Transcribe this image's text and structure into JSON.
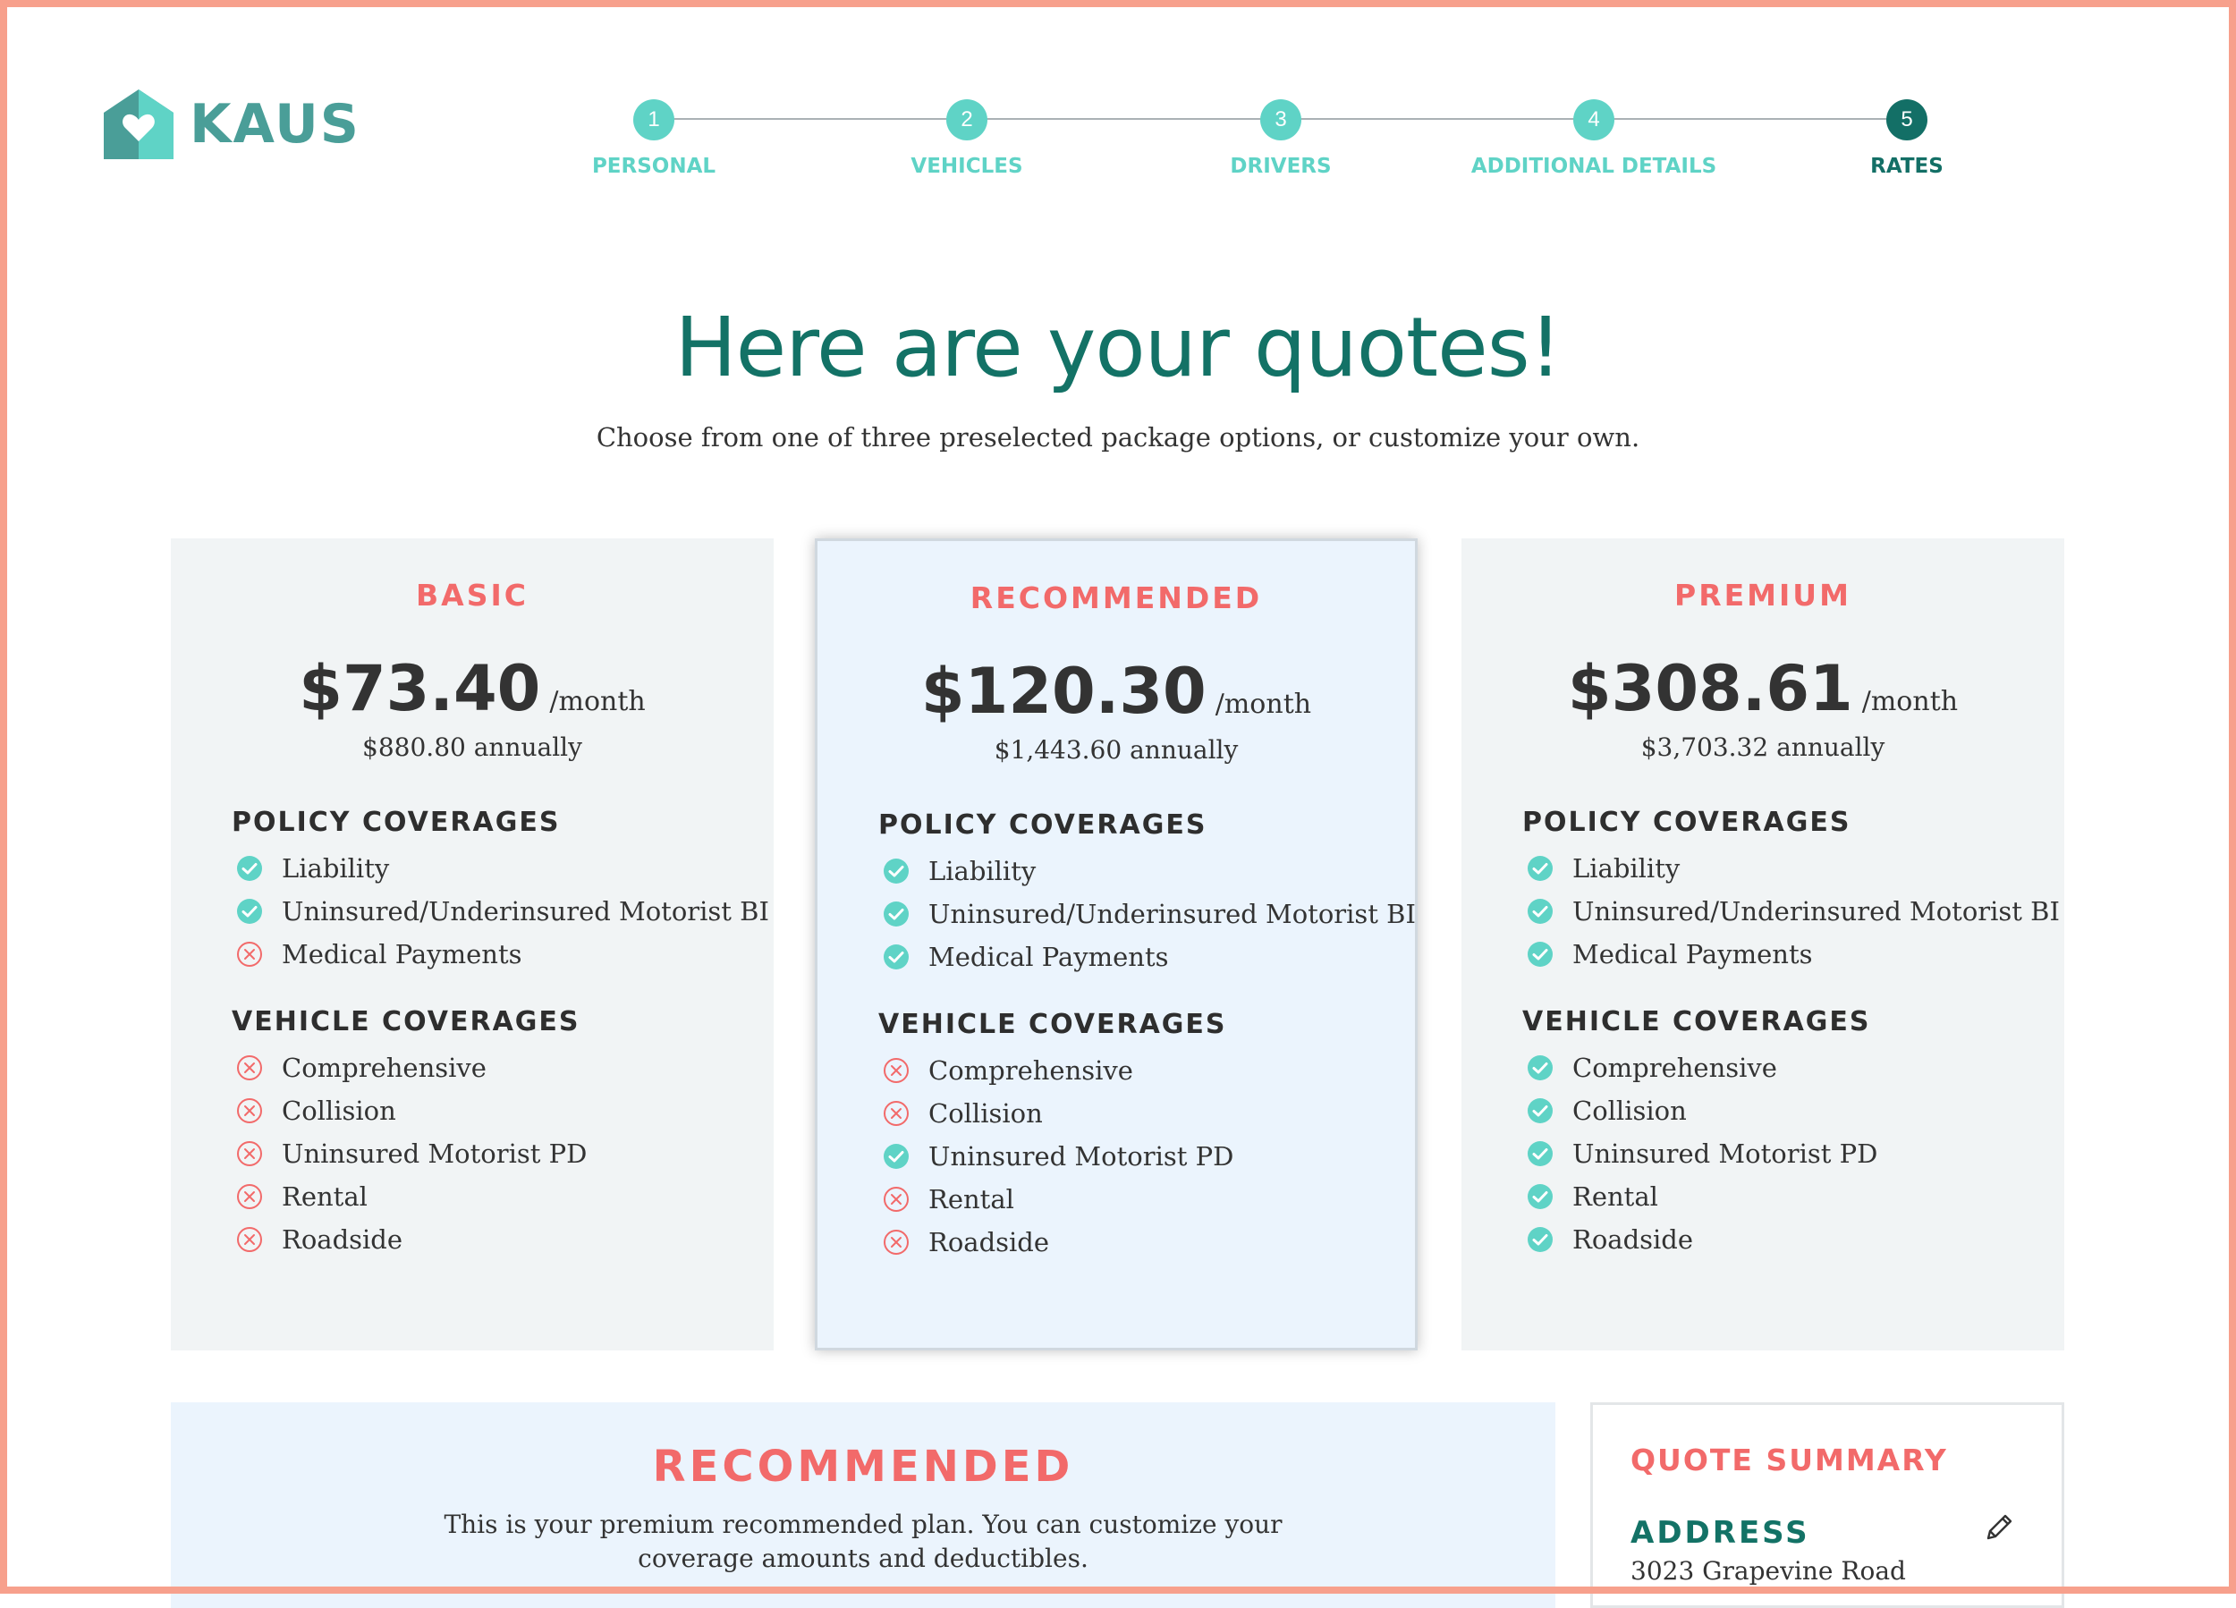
{
  "brand": {
    "name": "KAUS"
  },
  "colors": {
    "accent_teal": "#5fd3c6",
    "dark_teal": "#137266",
    "coral": "#f26a6a",
    "frame": "#f7a08c"
  },
  "stepper": {
    "steps": [
      {
        "number": "1",
        "label": "PERSONAL",
        "state": "complete"
      },
      {
        "number": "2",
        "label": "VEHICLES",
        "state": "complete"
      },
      {
        "number": "3",
        "label": "DRIVERS",
        "state": "complete"
      },
      {
        "number": "4",
        "label": "ADDITIONAL DETAILS",
        "state": "complete"
      },
      {
        "number": "5",
        "label": "RATES",
        "state": "active"
      }
    ]
  },
  "header": {
    "title": "Here are your quotes!",
    "subtitle": "Choose from one of three preselected package options, or customize your own."
  },
  "plans": [
    {
      "name": "BASIC",
      "price": "$73.40",
      "per": "/month",
      "annual": "$880.80 annually",
      "policy_title": "POLICY COVERAGES",
      "policy": [
        {
          "label": "Liability",
          "included": true
        },
        {
          "label": "Uninsured/Underinsured Motorist BI",
          "included": true
        },
        {
          "label": "Medical Payments",
          "included": false
        }
      ],
      "vehicle_title": "VEHICLE COVERAGES",
      "vehicle": [
        {
          "label": "Comprehensive",
          "included": false
        },
        {
          "label": "Collision",
          "included": false
        },
        {
          "label": "Uninsured Motorist PD",
          "included": false
        },
        {
          "label": "Rental",
          "included": false
        },
        {
          "label": "Roadside",
          "included": false
        }
      ]
    },
    {
      "name": "RECOMMENDED",
      "price": "$120.30",
      "per": "/month",
      "annual": "$1,443.60 annually",
      "policy_title": "POLICY COVERAGES",
      "policy": [
        {
          "label": "Liability",
          "included": true
        },
        {
          "label": "Uninsured/Underinsured Motorist BI",
          "included": true
        },
        {
          "label": "Medical Payments",
          "included": true
        }
      ],
      "vehicle_title": "VEHICLE COVERAGES",
      "vehicle": [
        {
          "label": "Comprehensive",
          "included": false
        },
        {
          "label": "Collision",
          "included": false
        },
        {
          "label": "Uninsured Motorist PD",
          "included": true
        },
        {
          "label": "Rental",
          "included": false
        },
        {
          "label": "Roadside",
          "included": false
        }
      ]
    },
    {
      "name": "PREMIUM",
      "price": "$308.61",
      "per": "/month",
      "annual": "$3,703.32 annually",
      "policy_title": "POLICY COVERAGES",
      "policy": [
        {
          "label": "Liability",
          "included": true
        },
        {
          "label": "Uninsured/Underinsured Motorist BI",
          "included": true
        },
        {
          "label": "Medical Payments",
          "included": true
        }
      ],
      "vehicle_title": "VEHICLE COVERAGES",
      "vehicle": [
        {
          "label": "Comprehensive",
          "included": true
        },
        {
          "label": "Collision",
          "included": true
        },
        {
          "label": "Uninsured Motorist PD",
          "included": true
        },
        {
          "label": "Rental",
          "included": true
        },
        {
          "label": "Roadside",
          "included": true
        }
      ]
    }
  ],
  "recommended_panel": {
    "title": "RECOMMENDED",
    "text": "This is your premium recommended plan. You can customize your coverage amounts and deductibles."
  },
  "quote_summary": {
    "title": "QUOTE SUMMARY",
    "address_label": "ADDRESS",
    "address_value": "3023 Grapevine Road",
    "edit_icon": "pencil-icon"
  }
}
